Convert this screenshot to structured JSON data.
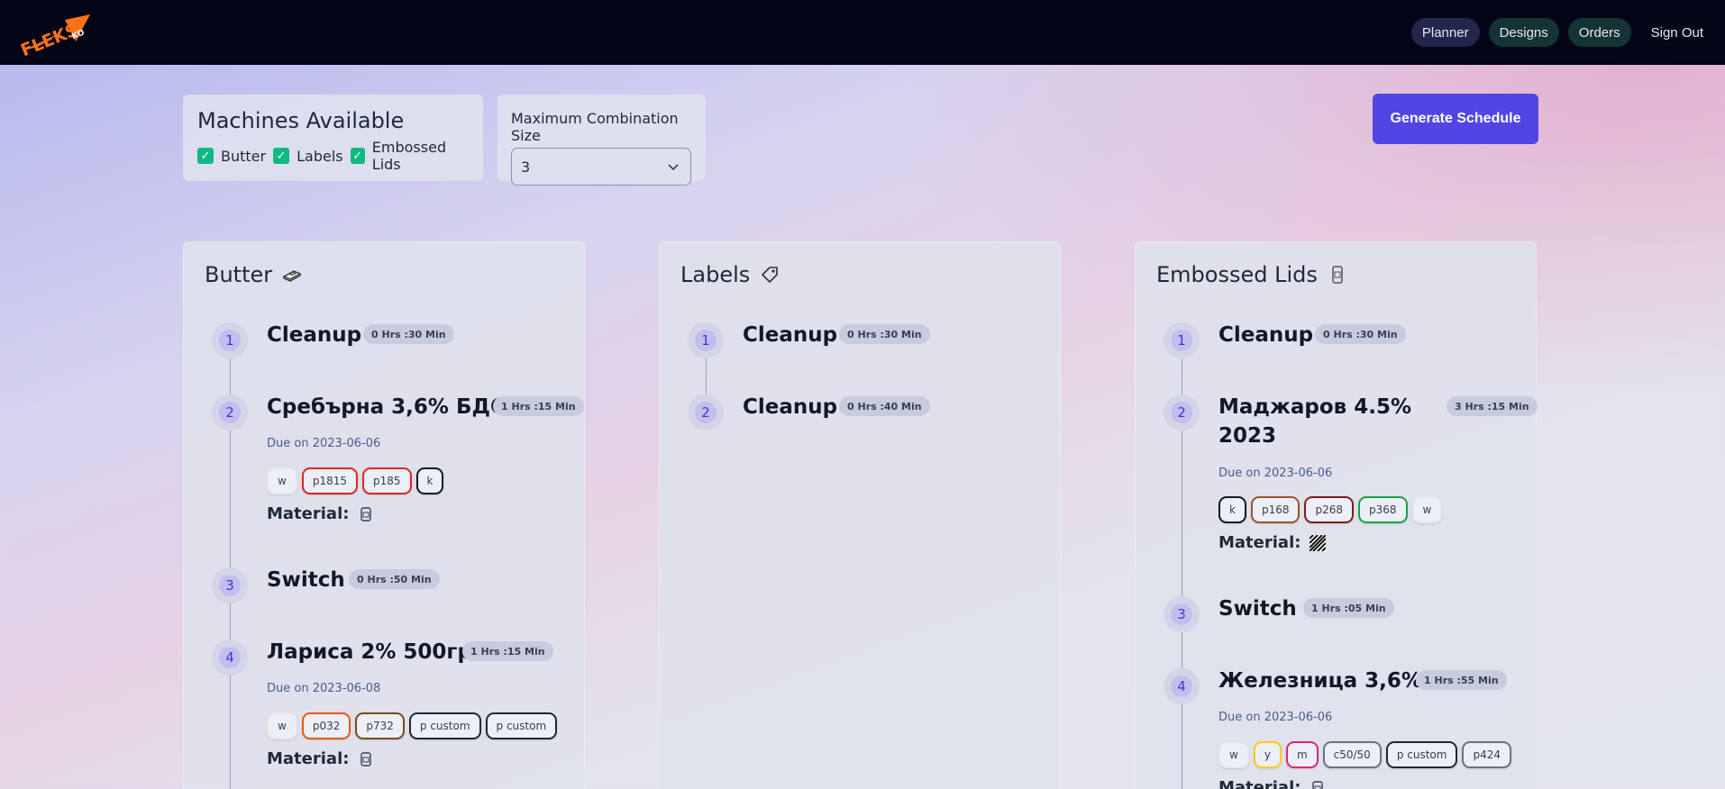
{
  "nav": {
    "logo_text": "FLEKS",
    "logo_sub": "KO",
    "links": [
      "Planner",
      "Designs",
      "Orders",
      "Sign Out"
    ]
  },
  "machines": {
    "title": "Machines Available",
    "options": [
      {
        "label": "Butter",
        "checked": true
      },
      {
        "label": "Labels",
        "checked": true
      },
      {
        "label": "Embossed Lids",
        "checked": true
      }
    ]
  },
  "combo": {
    "label": "Maximum Combination Size",
    "value": "3"
  },
  "generate_label": "Generate Schedule",
  "material_label": "Material:",
  "columns": [
    {
      "title": "Butter",
      "icon": "butter-icon",
      "steps": [
        {
          "num": "1",
          "title": "Cleanup",
          "duration": "0 Hrs :30 Min"
        },
        {
          "num": "2",
          "title": "Сребърна 3,6% БДС",
          "duration": "1 Hrs :15 Min",
          "due": "Due on 2023-06-06",
          "tags": [
            {
              "t": "w",
              "c": "#e5e7eb"
            },
            {
              "t": "p1815",
              "c": "#dc2626"
            },
            {
              "t": "p185",
              "c": "#dc2626"
            },
            {
              "t": "k",
              "c": "#111827"
            }
          ],
          "material_icon": "cup-icon"
        },
        {
          "num": "3",
          "title": "Switch",
          "duration": "0 Hrs :50 Min"
        },
        {
          "num": "4",
          "title": "Лариса 2% 500гр",
          "duration": "1 Hrs :15 Min",
          "due": "Due on 2023-06-08",
          "tags": [
            {
              "t": "w",
              "c": "#e5e7eb"
            },
            {
              "t": "p032",
              "c": "#ea580c"
            },
            {
              "t": "p732",
              "c": "#7c4a1e"
            },
            {
              "t": "p custom",
              "c": "#1f2937"
            },
            {
              "t": "p custom",
              "c": "#1f2937"
            }
          ],
          "material_icon": "cup-icon"
        }
      ]
    },
    {
      "title": "Labels",
      "icon": "tag-icon",
      "steps": [
        {
          "num": "1",
          "title": "Cleanup",
          "duration": "0 Hrs :30 Min"
        },
        {
          "num": "2",
          "title": "Cleanup",
          "duration": "0 Hrs :40 Min"
        }
      ]
    },
    {
      "title": "Embossed Lids",
      "icon": "lid-icon",
      "steps": [
        {
          "num": "1",
          "title": "Cleanup",
          "duration": "0 Hrs :30 Min"
        },
        {
          "num": "2",
          "title_lines": [
            "Маджаров 4.5%",
            "2023"
          ],
          "duration": "3 Hrs :15 Min",
          "due": "Due on 2023-06-06",
          "tags": [
            {
              "t": "k",
              "c": "#111827"
            },
            {
              "t": "p168",
              "c": "#a0522d"
            },
            {
              "t": "p268",
              "c": "#7f1d1d"
            },
            {
              "t": "p368",
              "c": "#16a34a"
            },
            {
              "t": "w",
              "c": "#e5e7eb"
            }
          ],
          "material_icon": "striped-icon"
        },
        {
          "num": "3",
          "title": "Switch",
          "duration": "1 Hrs :05 Min"
        },
        {
          "num": "4",
          "title": "Железница 3,6%",
          "duration": "1 Hrs :55 Min",
          "due": "Due on 2023-06-06",
          "tags": [
            {
              "t": "w",
              "c": "#e5e7eb"
            },
            {
              "t": "y",
              "c": "#facc15"
            },
            {
              "t": "m",
              "c": "#db2777"
            },
            {
              "t": "c50/50",
              "c": "#6b7280"
            },
            {
              "t": "p custom",
              "c": "#1f2937"
            },
            {
              "t": "p424",
              "c": "#6b7280"
            }
          ],
          "material_icon": "cup-icon"
        }
      ]
    }
  ]
}
